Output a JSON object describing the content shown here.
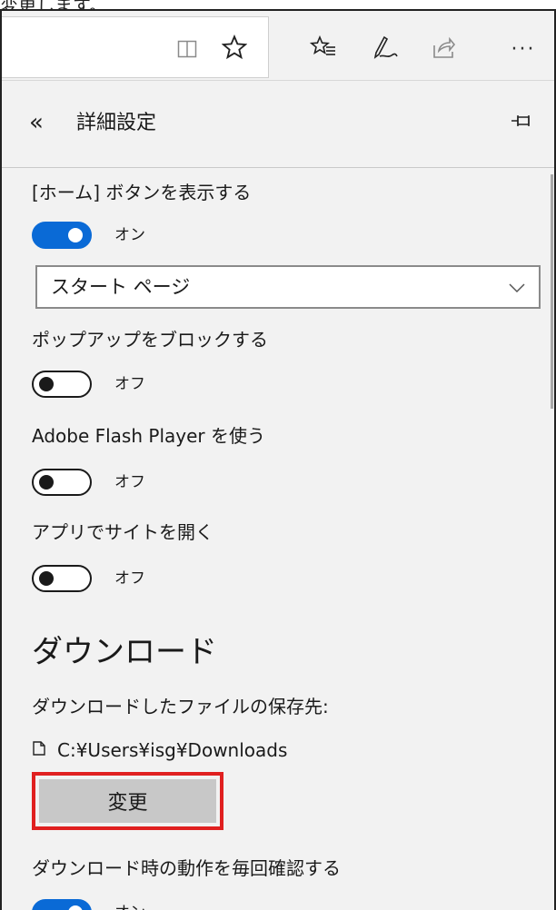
{
  "caption": "変更します。",
  "toolbar": {
    "reading_view_icon": "book-icon",
    "favorite_icon": "star-icon",
    "hub_icon": "favorites-hub-icon",
    "notes_icon": "pen-icon",
    "share_icon": "share-icon",
    "more_label": "···"
  },
  "panel": {
    "back_label": "«",
    "title": "詳細設定",
    "pin_icon": "pin-icon"
  },
  "settings": {
    "home_button": {
      "label": "[ホーム] ボタンを表示する",
      "state": "オン",
      "on": true
    },
    "home_page_select": {
      "value": "スタート ページ"
    },
    "popup_block": {
      "label": "ポップアップをブロックする",
      "state": "オフ",
      "on": false
    },
    "flash": {
      "label": "Adobe Flash Player を使う",
      "state": "オフ",
      "on": false
    },
    "open_in_app": {
      "label": "アプリでサイトを開く",
      "state": "オフ",
      "on": false
    }
  },
  "downloads": {
    "heading": "ダウンロード",
    "save_location_label": "ダウンロードしたファイルの保存先:",
    "path": "C:¥Users¥isg¥Downloads",
    "change_button": "変更",
    "ask_each_time": {
      "label": "ダウンロード時の動作を毎回確認する",
      "state": "オン",
      "on": true
    }
  },
  "colors": {
    "toggle_on": "#0a6ad6",
    "highlight": "#e02020",
    "button_bg": "#c8c8c8",
    "panel_bg": "#f2f2f2"
  }
}
